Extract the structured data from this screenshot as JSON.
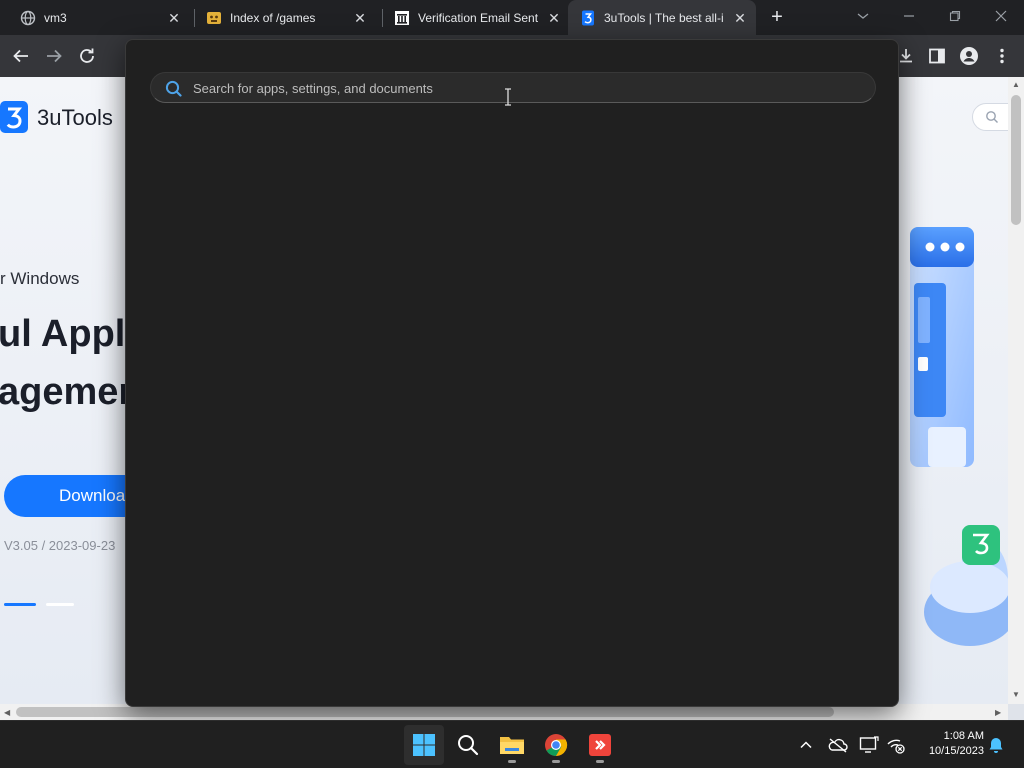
{
  "browser": {
    "tabs": [
      {
        "title": "vm3",
        "favicon": "globe-icon",
        "active": false
      },
      {
        "title": "Index of /games",
        "favicon": "emoji-icon",
        "active": false
      },
      {
        "title": "Verification Email Sent",
        "favicon": "bank-icon",
        "active": false
      },
      {
        "title": "3uTools | The best all-i",
        "favicon": "3utools-icon",
        "active": true
      }
    ],
    "new_tab_label": "+",
    "close_glyph": "✕"
  },
  "page": {
    "logo_text": "3uTools",
    "sub_heading": "r Windows",
    "hero_line_1": "ul Appl",
    "hero_line_2": "agemer",
    "download_label": "Downloa",
    "version_text": "V3.05 / 2023-09-23"
  },
  "search_panel": {
    "placeholder": "Search for apps, settings, and documents",
    "value": ""
  },
  "taskbar": {
    "apps": [
      "start-icon",
      "search-icon",
      "file-explorer-icon",
      "chrome-icon",
      "anydesk-icon"
    ],
    "tray": [
      "chevron-up-icon",
      "onedrive-icon",
      "display-icon",
      "network-icon"
    ],
    "time": "1:08 AM",
    "date": "10/15/2023",
    "notification_icon": "bell-icon"
  },
  "colors": {
    "accent": "#1677ff",
    "panel_bg": "#202020",
    "taskbar_bg": "#202020",
    "chrome_bg": "#202124"
  }
}
